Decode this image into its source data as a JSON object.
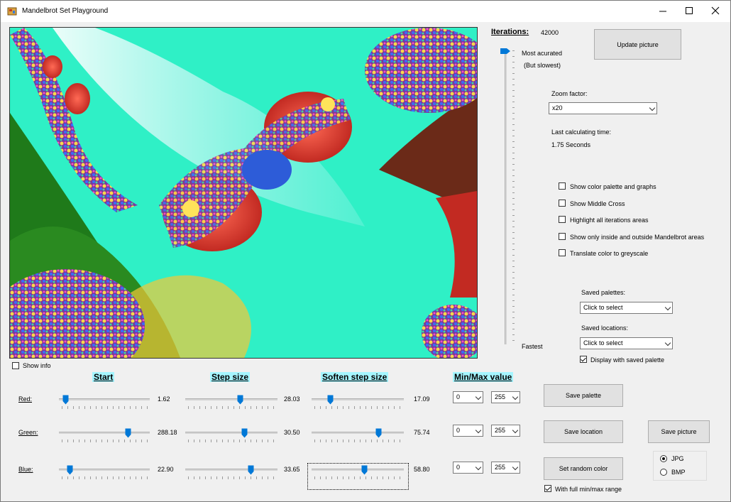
{
  "window": {
    "title": "Mandelbrot Set Playground"
  },
  "iterations": {
    "label": "Iterations:",
    "value": "42000",
    "top_label": "Most acurated",
    "top_sub": "(But slowest)",
    "bottom_label": "Fastest",
    "level": 0.0
  },
  "buttons": {
    "update_picture": "Update picture",
    "save_palette": "Save  palette",
    "save_location": "Save location",
    "save_picture": "Save picture",
    "random_color": "Set random color"
  },
  "zoom": {
    "label": "Zoom factor:",
    "value": "x20"
  },
  "calc": {
    "label": "Last calculating time:",
    "value": "1.75 Seconds"
  },
  "options": [
    {
      "label": "Show color palette and graphs",
      "checked": false
    },
    {
      "label": "Show Middle Cross",
      "checked": false
    },
    {
      "label": "Highlight all iterations areas",
      "checked": false
    },
    {
      "label": "Show only inside and outside Mandelbrot areas",
      "checked": false
    },
    {
      "label": "Translate color to greyscale",
      "checked": false
    }
  ],
  "saved_palettes": {
    "label": "Saved palettes:",
    "value": "Click to select"
  },
  "saved_locations": {
    "label": "Saved locations:",
    "value": "Click to select"
  },
  "display_saved_palette": {
    "label": "Display with saved palette",
    "checked": true
  },
  "show_info": {
    "label": "Show info",
    "checked": false
  },
  "headers": {
    "start": "Start",
    "step": "Step size",
    "soften": "Soften step size",
    "minmax": "Min/Max value"
  },
  "channels": [
    {
      "label": "Red:",
      "start": "1.62",
      "step": "28.03",
      "soften": "17.09",
      "min": "0",
      "max": "255",
      "start_pos": 0.04,
      "step_pos": 0.6,
      "soften_pos": 0.18
    },
    {
      "label": "Green:",
      "start": "288.18",
      "step": "30.50",
      "soften": "75.74",
      "min": "0",
      "max": "255",
      "start_pos": 0.78,
      "step_pos": 0.65,
      "soften_pos": 0.74
    },
    {
      "label": "Blue:",
      "start": "22.90",
      "step": "33.65",
      "soften": "58.80",
      "min": "0",
      "max": "255",
      "start_pos": 0.09,
      "step_pos": 0.73,
      "soften_pos": 0.58
    }
  ],
  "full_range": {
    "label": "With full min/max range",
    "checked": true
  },
  "format": {
    "options": [
      "JPG",
      "BMP"
    ],
    "selected": "JPG"
  },
  "colors": {
    "slider_thumb": "#0078d7",
    "header_bg": "#a5f5ff",
    "window_bg": "#f0f0f0"
  }
}
